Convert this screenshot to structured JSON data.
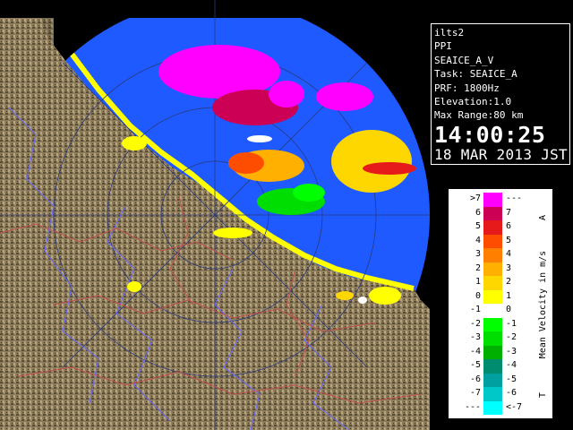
{
  "info": {
    "site": "ilts2",
    "product": "PPI",
    "task_name": "SEAICE_A_V",
    "task": "Task: SEAICE_A",
    "prf": "PRF: 1800Hz",
    "elevation": "Elevation:1.0",
    "max_range": "Max Range:80 km",
    "time": "14:00:25",
    "date": "18 MAR 2013 JST"
  },
  "legend": {
    "title": "Mean Velocity in m/s",
    "arrow_top": "A",
    "arrow_bottom": "T",
    "rows": [
      {
        "left": ">7",
        "right": "---",
        "color": "#ff00ff"
      },
      {
        "left": "6",
        "right": "7",
        "color": "#cc0055"
      },
      {
        "left": "5",
        "right": "6",
        "color": "#e61a1a"
      },
      {
        "left": "4",
        "right": "5",
        "color": "#ff4d00"
      },
      {
        "left": "3",
        "right": "4",
        "color": "#ff8000"
      },
      {
        "left": "2",
        "right": "3",
        "color": "#ffb000"
      },
      {
        "left": "1",
        "right": "2",
        "color": "#ffd700"
      },
      {
        "left": "0",
        "right": "1",
        "color": "#ffff00"
      },
      {
        "left": "-1",
        "right": "0",
        "color": "#ffffff"
      },
      {
        "left": "-2",
        "right": "-1",
        "color": "#00ff00"
      },
      {
        "left": "-3",
        "right": "-2",
        "color": "#00dd00"
      },
      {
        "left": "-4",
        "right": "-3",
        "color": "#00b000"
      },
      {
        "left": "-5",
        "right": "-4",
        "color": "#008c6e"
      },
      {
        "left": "-6",
        "right": "-5",
        "color": "#00a0a0"
      },
      {
        "left": "-7",
        "right": "-6",
        "color": "#00c8c8"
      },
      {
        "left": "---",
        "right": "<-7",
        "color": "#00ffff"
      }
    ]
  },
  "map": {
    "sea_color": "#1e5aff",
    "land_color": "#8a7a5a"
  }
}
